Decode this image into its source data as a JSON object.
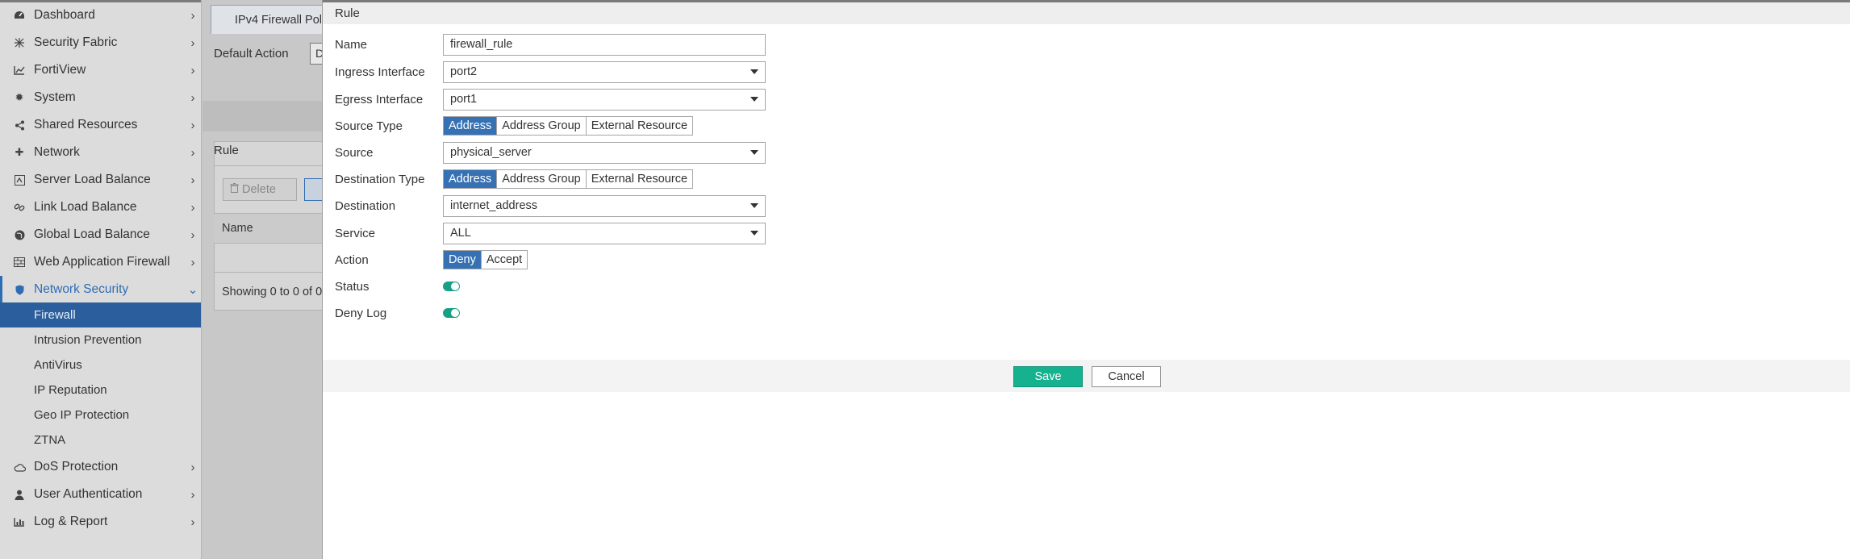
{
  "sidebar": {
    "items": [
      {
        "label": "Dashboard",
        "icon": "dashboard-icon"
      },
      {
        "label": "Security Fabric",
        "icon": "security-fabric-icon"
      },
      {
        "label": "FortiView",
        "icon": "chart-icon"
      },
      {
        "label": "System",
        "icon": "gear-icon"
      },
      {
        "label": "Shared Resources",
        "icon": "share-icon"
      },
      {
        "label": "Network",
        "icon": "network-icon"
      },
      {
        "label": "Server Load Balance",
        "icon": "server-load-balance-icon"
      },
      {
        "label": "Link Load Balance",
        "icon": "link-icon"
      },
      {
        "label": "Global Load Balance",
        "icon": "globe-icon"
      },
      {
        "label": "Web Application Firewall",
        "icon": "waf-icon"
      },
      {
        "label": "Network Security",
        "icon": "shield-icon"
      }
    ],
    "sub_items": [
      "Firewall",
      "Intrusion Prevention",
      "AntiVirus",
      "IP Reputation",
      "Geo IP Protection",
      "ZTNA"
    ],
    "bottom_items": [
      {
        "label": "DoS Protection",
        "icon": "cloud-icon"
      },
      {
        "label": "User Authentication",
        "icon": "user-icon"
      },
      {
        "label": "Log & Report",
        "icon": "log-report-icon"
      }
    ]
  },
  "background": {
    "tab_label": "IPv4 Firewall Polic",
    "default_action_label": "Default Action",
    "default_action_value": "D",
    "panel_title": "Rule",
    "delete_label": "Delete",
    "name_column": "Name",
    "showing_text": "Showing 0 to 0 of 0"
  },
  "modal": {
    "title": "Rule",
    "fields": {
      "name": {
        "label": "Name",
        "value": "firewall_rule"
      },
      "ingress": {
        "label": "Ingress Interface",
        "value": "port2"
      },
      "egress": {
        "label": "Egress Interface",
        "value": "port1"
      },
      "source_type": {
        "label": "Source Type",
        "options": [
          "Address",
          "Address Group",
          "External Resource"
        ],
        "selected": "Address"
      },
      "source": {
        "label": "Source",
        "value": "physical_server"
      },
      "destination_type": {
        "label": "Destination Type",
        "options": [
          "Address",
          "Address Group",
          "External Resource"
        ],
        "selected": "Address"
      },
      "destination": {
        "label": "Destination",
        "value": "internet_address"
      },
      "service": {
        "label": "Service",
        "value": "ALL"
      },
      "action": {
        "label": "Action",
        "options": [
          "Deny",
          "Accept"
        ],
        "selected": "Deny"
      },
      "status": {
        "label": "Status",
        "enabled": true
      },
      "deny_log": {
        "label": "Deny Log",
        "enabled": true
      }
    },
    "save_label": "Save",
    "cancel_label": "Cancel"
  },
  "colors": {
    "accent": "#3671b3",
    "selected_nav": "#2a5e9c",
    "save": "#16b28f",
    "toggle_on": "#16a085"
  }
}
